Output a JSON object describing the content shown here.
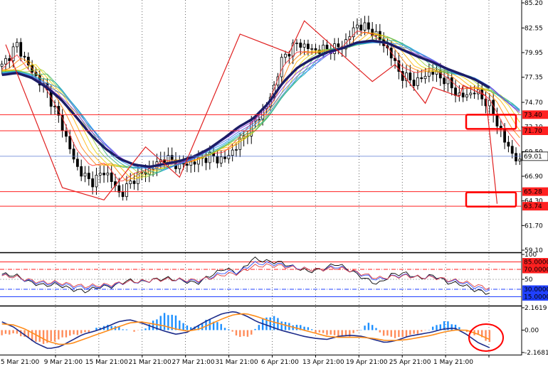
{
  "chart_data": [
    {
      "type": "candlestick",
      "panel": "price",
      "ylim": [
        59.1,
        85.2
      ],
      "y_ticks": [
        "85.20",
        "82.55",
        "79.95",
        "77.35",
        "74.70",
        "72.10",
        "69.50",
        "66.90",
        "64.30",
        "61.70",
        "59.10"
      ],
      "x_ticks": [
        "5 Mar 21:00",
        "9 Mar 21:00",
        "15 Mar 21:00",
        "21 Mar 21:00",
        "27 Mar 21:00",
        "31 Mar 21:00",
        "6 Apr 21:00",
        "13 Apr 21:00",
        "19 Apr 21:00",
        "25 Apr 21:00",
        "1 May 21:00"
      ],
      "close_path": [
        78.5,
        80.8,
        78.0,
        76.0,
        72.5,
        68.0,
        66.2,
        67.5,
        64.9,
        66.8,
        67.6,
        68.9,
        68.0,
        68.4,
        69.0,
        68.6,
        70.3,
        72.6,
        74.5,
        79.5,
        81.0,
        80.2,
        80.3,
        80.6,
        82.9,
        82.3,
        80.5,
        77.5,
        76.8,
        78.0,
        77.0,
        75.2,
        75.9,
        74.3,
        70.5,
        68.2
      ],
      "moving_average": [
        77.6,
        77.8,
        77.3,
        76.3,
        75.0,
        73.2,
        71.3,
        69.8,
        68.7,
        68.1,
        67.9,
        68.2,
        68.5,
        69.0,
        69.8,
        70.9,
        72.1,
        73.0,
        74.6,
        76.8,
        78.4,
        79.3,
        80.0,
        80.4,
        81.0,
        81.2,
        81.0,
        80.3,
        79.6,
        79.0,
        78.3,
        77.7,
        77.1,
        76.2,
        74.8,
        73.5
      ],
      "zigzag": [
        [
          1,
          80.8
        ],
        [
          16,
          65.7
        ],
        [
          27,
          64.4
        ],
        [
          38,
          70.0
        ],
        [
          47,
          66.8
        ],
        [
          63,
          81.9
        ],
        [
          76,
          79.9
        ],
        [
          80,
          83.3
        ],
        [
          98,
          76.9
        ],
        [
          104,
          78.7
        ],
        [
          112,
          74.6
        ],
        [
          114,
          76.3
        ],
        [
          121,
          75.3
        ],
        [
          122,
          76.5
        ],
        [
          128,
          75.4
        ],
        [
          131,
          64.0
        ]
      ],
      "levels": [
        {
          "label": "73.40",
          "value": 73.4,
          "color": "#ff2020"
        },
        {
          "label": "71.70",
          "value": 71.7,
          "color": "#ff2020"
        },
        {
          "label": "65.28",
          "value": 65.28,
          "color": "#ff2020"
        },
        {
          "label": "63.74",
          "value": 63.74,
          "color": "#ff2020"
        }
      ],
      "current_price": {
        "label": "69.01",
        "value": 69.01
      },
      "highlight_boxes": [
        {
          "from": 71.9,
          "to": 73.4
        },
        {
          "from": 63.7,
          "to": 65.2
        }
      ]
    },
    {
      "type": "line",
      "panel": "rsi",
      "ylim": [
        0,
        100
      ],
      "y_ticks": [
        "100",
        "50"
      ],
      "levels": [
        {
          "label": "85.0000",
          "value": 85,
          "color": "#ff2020"
        },
        {
          "label": "70.0000",
          "value": 70,
          "color": "#ff2020"
        },
        {
          "label": "30.0000",
          "value": 30,
          "color": "#2040ff"
        },
        {
          "label": "15.0000",
          "value": 15,
          "color": "#2040ff"
        }
      ],
      "series": [
        {
          "color": "#000000",
          "values": [
            60,
            58,
            44,
            38,
            40,
            30,
            26,
            35,
            36,
            48,
            44,
            50,
            52,
            47,
            42,
            58,
            72,
            62,
            92,
            86,
            84,
            74,
            66,
            70,
            82,
            68,
            52,
            40,
            60,
            62,
            52,
            58,
            44,
            40,
            28,
            22
          ]
        },
        {
          "color": "#3050ff",
          "values": [
            58,
            55,
            46,
            42,
            42,
            36,
            33,
            36,
            38,
            45,
            45,
            49,
            50,
            48,
            46,
            54,
            65,
            64,
            82,
            82,
            80,
            74,
            70,
            70,
            76,
            68,
            58,
            49,
            56,
            58,
            54,
            55,
            48,
            44,
            34,
            28
          ]
        },
        {
          "color": "#e04040",
          "values": [
            57,
            55,
            48,
            44,
            44,
            39,
            36,
            38,
            40,
            45,
            46,
            49,
            50,
            49,
            48,
            53,
            60,
            62,
            76,
            78,
            77,
            73,
            70,
            70,
            73,
            68,
            60,
            52,
            55,
            57,
            54,
            54,
            49,
            46,
            38,
            32
          ]
        }
      ]
    },
    {
      "type": "bar",
      "panel": "macd",
      "ylim": [
        -2.1681,
        2.1619
      ],
      "y_ticks": [
        "2.1619",
        "0.00",
        "-2.1681"
      ],
      "histogram": [
        -0.5,
        -0.3,
        -0.6,
        -1.1,
        -1.3,
        -1.0,
        -0.6,
        -0.4,
        -0.2,
        0.3,
        0.5,
        0.2,
        -0.1,
        0.0,
        0.9,
        1.6,
        1.4,
        0.4,
        0.3,
        1.1,
        0.7,
        0.0,
        -0.7,
        -0.5,
        1.0,
        1.4,
        0.8,
        0.5,
        0.4,
        -0.2,
        -0.4,
        -0.6,
        -0.6,
        0.0,
        0.8,
        -0.4,
        -0.7,
        -0.7,
        -0.4,
        -0.1,
        0.4,
        0.9,
        0.4,
        -0.3,
        -0.5,
        -1.2
      ],
      "macd_line": [
        0.8,
        0.3,
        -0.5,
        -1.3,
        -1.8,
        -1.6,
        -1.0,
        -0.4,
        -0.1,
        0.3,
        0.8,
        1.0,
        0.7,
        0.3,
        -0.1,
        -0.4,
        -0.2,
        0.5,
        1.1,
        1.6,
        1.8,
        1.4,
        0.8,
        0.4,
        0.0,
        -0.3,
        -0.6,
        -0.8,
        -0.9,
        -0.6,
        -0.5,
        -0.6,
        -0.9,
        -1.2,
        -1.0,
        -0.6,
        -0.4,
        -0.2,
        0.1,
        0.2,
        -0.4,
        -1.2,
        -1.7
      ],
      "signal_line": [
        0.6,
        0.5,
        0.1,
        -0.5,
        -1.1,
        -1.4,
        -1.3,
        -0.9,
        -0.5,
        -0.1,
        0.3,
        0.7,
        0.8,
        0.6,
        0.4,
        0.1,
        -0.1,
        0.1,
        0.6,
        1.1,
        1.5,
        1.6,
        1.3,
        0.9,
        0.6,
        0.3,
        0.0,
        -0.3,
        -0.6,
        -0.7,
        -0.7,
        -0.7,
        -0.8,
        -1.0,
        -1.0,
        -0.9,
        -0.7,
        -0.5,
        -0.2,
        0.0,
        0.0,
        -0.4,
        -0.9
      ]
    }
  ]
}
